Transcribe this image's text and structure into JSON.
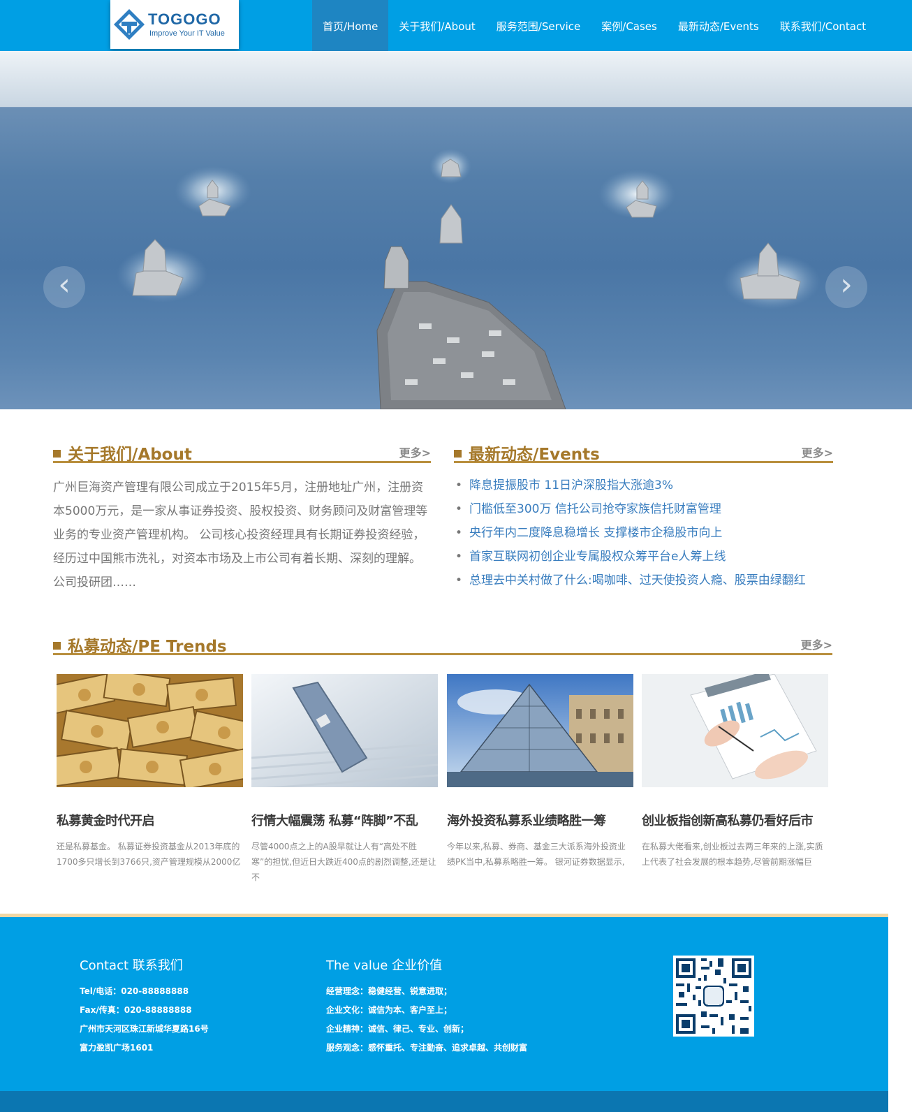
{
  "header": {
    "logo_title": "TOGOGO",
    "logo_subtitle": "Improve Your IT Value",
    "nav": [
      {
        "label": "首页/Home",
        "active": true
      },
      {
        "label": "关于我们/About",
        "active": false
      },
      {
        "label": "服务范围/Service",
        "active": false
      },
      {
        "label": "案例/Cases",
        "active": false
      },
      {
        "label": "最新动态/Events",
        "active": false
      },
      {
        "label": "联系我们/Contact",
        "active": false
      }
    ]
  },
  "banner": {
    "prev_arrow": "‹",
    "next_arrow": "›"
  },
  "about": {
    "title": "关于我们/About",
    "more": "更多>",
    "text": "广州巨海资产管理有限公司成立于2015年5月，注册地址广州，注册资本5000万元，是一家从事证券投资、股权投资、财务顾问及财富管理等业务的专业资产管理机构。 公司核心投资经理具有长期证券投资经验，经历过中国熊市洗礼，对资本市场及上市公司有着长期、深刻的理解。公司投研团……"
  },
  "events": {
    "title": "最新动态/Events",
    "more": "更多>",
    "items": [
      "降息提振股市 11日沪深股指大涨逾3%",
      "门槛低至300万 信托公司抢夺家族信托财富管理",
      "央行年内二度降息稳增长 支撑楼市企稳股市向上",
      "首家互联网初创企业专属股权众筹平台e人筹上线",
      "总理去中关村做了什么:喝咖啡、过天使投资人瘾、股票由绿翻红"
    ]
  },
  "pe": {
    "title": "私募动态/PE Trends",
    "more": "更多>",
    "cards": [
      {
        "title": "私募黄金时代开启",
        "desc": "还是私募基金。 私募证券投资基金从2013年底的1700多只增长到3766只,资产管理规模从2000亿",
        "image": "money-stack"
      },
      {
        "title": "行情大幅震荡 私募“阵脚”不乱",
        "desc": "尽管4000点之上的A股早就让人有“高处不胜寒”的担忧,但近日大跌近400点的剧烈调整,还是让不",
        "image": "bank-card"
      },
      {
        "title": "海外投资私募系业绩略胜一筹",
        "desc": "今年以来,私募、券商、基金三大派系海外投资业绩PK当中,私募系略胜一筹。 银河证券数据显示,",
        "image": "louvre-pyramid"
      },
      {
        "title": "创业板指创新高私募仍看好后市",
        "desc": "在私募大佬看来,创业板过去两三年来的上涨,实质上代表了社会发展的根本趋势,尽管前期涨幅巨",
        "image": "charts-document"
      }
    ]
  },
  "footer": {
    "contact": {
      "title": "Contact 联系我们",
      "lines": [
        "Tel/电话：020-88888888",
        "Fax/传真：020-88888888",
        "广州市天河区珠江新城华夏路16号",
        "富力盈凯广场1601"
      ]
    },
    "value": {
      "title": "The value 企业价值",
      "lines": [
        "经营理念：稳健经营、锐意进取；",
        "企业文化：诚信为本、客户至上；",
        "企业精神：诚信、律己、专业、创新；",
        "服务观念：感怀重托、专注勤奋、追求卓越、共创财富"
      ]
    },
    "qr_icon": "qr-code"
  },
  "colors": {
    "brand_blue": "#009fe4",
    "nav_active": "#1e85c2",
    "gold": "#a5782a",
    "link_blue": "#3a7ebf"
  }
}
